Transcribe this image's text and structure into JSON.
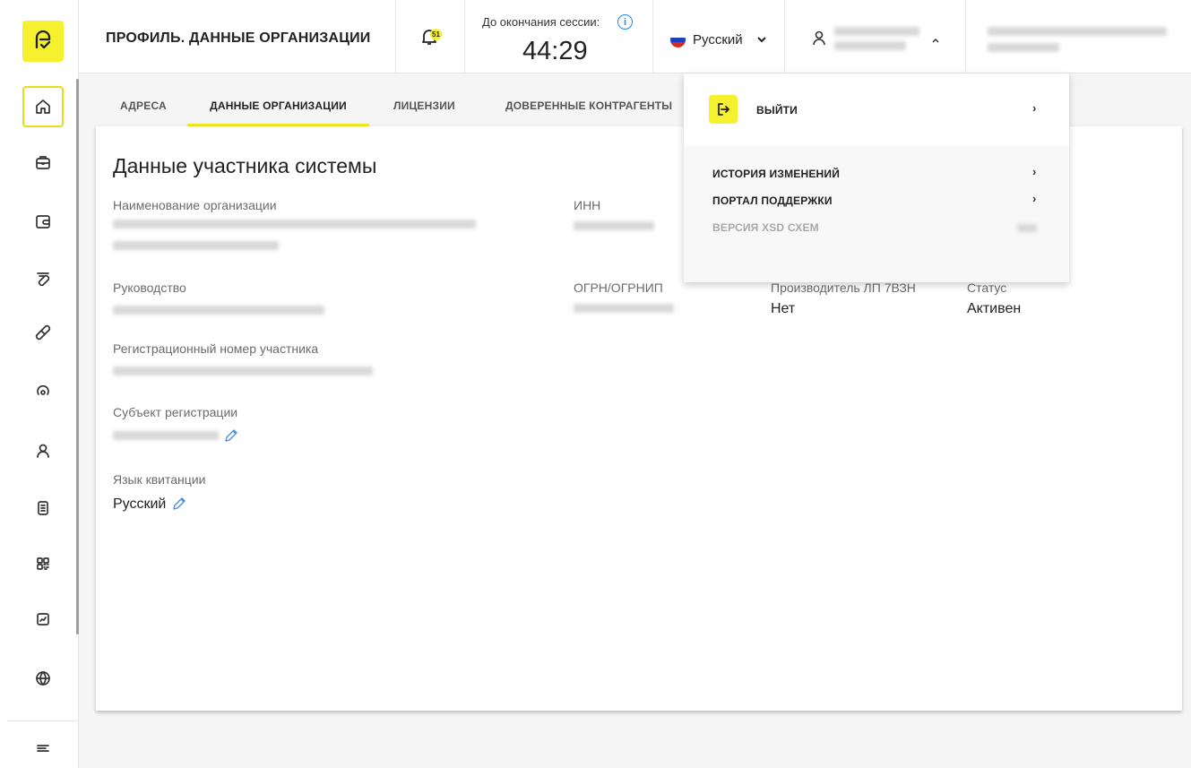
{
  "header": {
    "page_title": "ПРОФИЛЬ. ДАННЫЕ ОРГАНИЗАЦИИ",
    "notifications_count": "51",
    "session_label": "До окончания сессии:",
    "session_time": "44:29",
    "language": "Русский",
    "info_glyph": "i"
  },
  "tabs": [
    {
      "label": "АДРЕСА"
    },
    {
      "label": "ДАННЫЕ ОРГАНИЗАЦИИ"
    },
    {
      "label": "ЛИЦЕНЗИИ"
    },
    {
      "label": "ДОВЕРЕННЫЕ КОНТРАГЕНТЫ"
    }
  ],
  "card": {
    "title": "Данные участника системы",
    "labels": {
      "org_name": "Наименование организации",
      "inn": "ИНН",
      "management": "Руководство",
      "ogrn": "ОГРН/ОГРНИП",
      "manufacturer": "Производитель ЛП 7ВЗН",
      "status": "Статус",
      "reg_number": "Регистрационный номер участника",
      "reg_subject": "Субъект регистрации",
      "receipt_lang": "Язык квитанции"
    },
    "values": {
      "manufacturer": "Нет",
      "status": "Активен",
      "receipt_lang": "Русский"
    }
  },
  "dropdown": {
    "logout": "ВЫЙТИ",
    "history": "ИСТОРИЯ ИЗМЕНЕНИЙ",
    "support": "ПОРТАЛ ПОДДЕРЖКИ",
    "xsd": "ВЕРСИЯ XSD СХЕМ",
    "chevron": "›"
  },
  "colors": {
    "accent": "#f5f12f",
    "link": "#1e88e5"
  }
}
